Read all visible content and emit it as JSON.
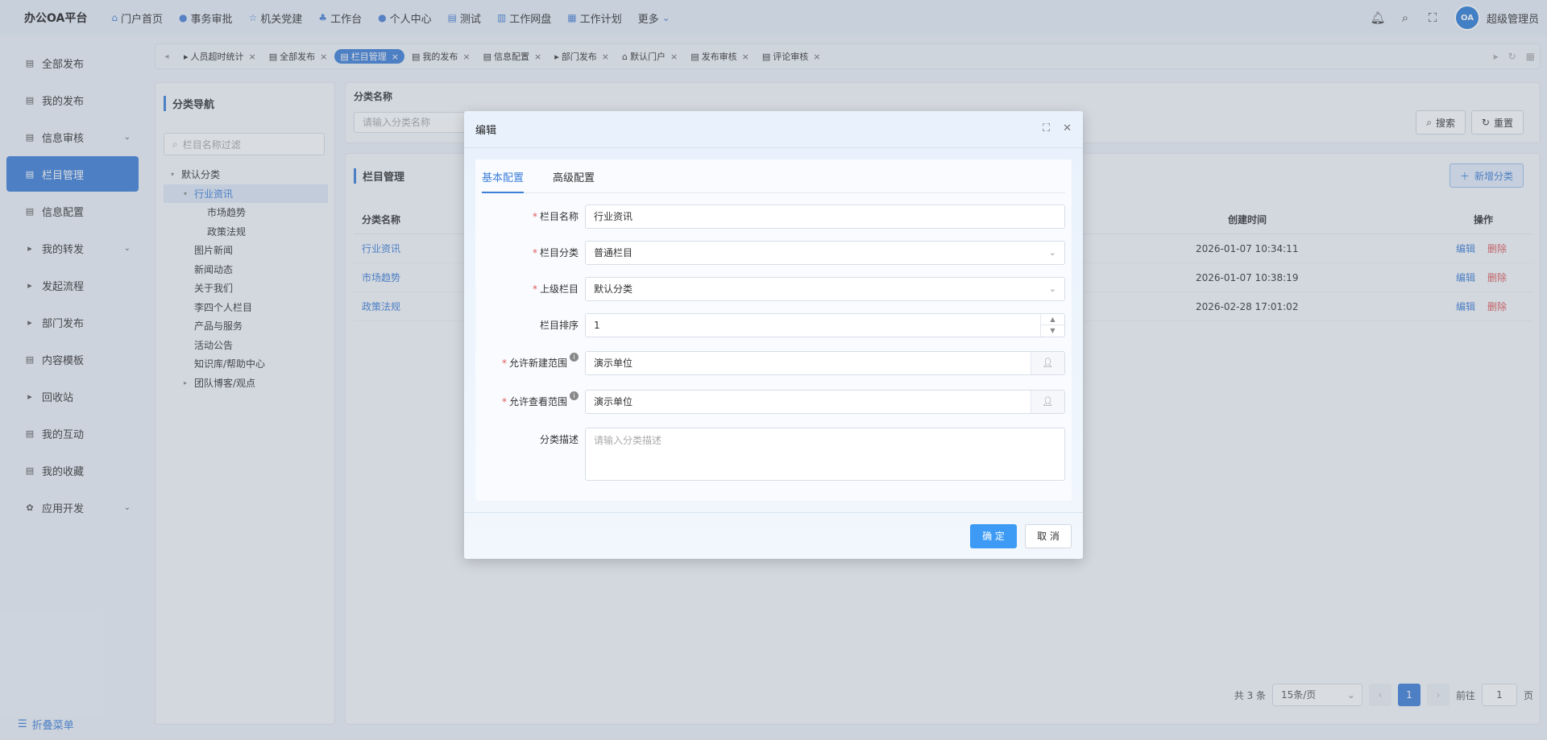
{
  "app": {
    "title": "办公OA平台",
    "user": "超级管理员",
    "avatar_text": "OA"
  },
  "topnav": [
    {
      "label": "门户首页",
      "icon": "home-icon",
      "glyph": "⌂"
    },
    {
      "label": "事务审批",
      "icon": "info-icon",
      "glyph": "●"
    },
    {
      "label": "机关党建",
      "icon": "star-icon",
      "glyph": "☆"
    },
    {
      "label": "工作台",
      "icon": "sitemap-icon",
      "glyph": "♣"
    },
    {
      "label": "个人中心",
      "icon": "user-icon",
      "glyph": "●"
    },
    {
      "label": "测试",
      "icon": "grid-icon",
      "glyph": "▤"
    },
    {
      "label": "工作网盘",
      "icon": "database-icon",
      "glyph": "▥"
    },
    {
      "label": "工作计划",
      "icon": "calendar-icon",
      "glyph": "▦"
    },
    {
      "label": "更多",
      "icon": "chevron-down-icon",
      "glyph": "⌄"
    }
  ],
  "sidebar": {
    "items": [
      {
        "label": "全部发布",
        "chev": "",
        "lead": "▤"
      },
      {
        "label": "我的发布",
        "chev": "",
        "lead": "▤"
      },
      {
        "label": "信息审核",
        "chev": "⌄",
        "lead": "▤"
      },
      {
        "label": "栏目管理",
        "chev": "",
        "lead": "▤"
      },
      {
        "label": "信息配置",
        "chev": "",
        "lead": "▤"
      },
      {
        "label": "我的转发",
        "chev": "⌄",
        "lead": "▸"
      },
      {
        "label": "发起流程",
        "chev": "",
        "lead": "▸"
      },
      {
        "label": "部门发布",
        "chev": "",
        "lead": "▸"
      },
      {
        "label": "内容模板",
        "chev": "",
        "lead": "▤"
      },
      {
        "label": "回收站",
        "chev": "",
        "lead": "▸"
      },
      {
        "label": "我的互动",
        "chev": "",
        "lead": "▤"
      },
      {
        "label": "我的收藏",
        "chev": "",
        "lead": "▤"
      },
      {
        "label": "应用开发",
        "chev": "⌄",
        "lead": "✿"
      }
    ],
    "collapse_label": "折叠菜单"
  },
  "tabs": [
    {
      "label": "人员超时统计",
      "lead": "▸"
    },
    {
      "label": "全部发布",
      "lead": "▤"
    },
    {
      "label": "栏目管理",
      "lead": "▤"
    },
    {
      "label": "我的发布",
      "lead": "▤"
    },
    {
      "label": "信息配置",
      "lead": "▤"
    },
    {
      "label": "部门发布",
      "lead": "▸"
    },
    {
      "label": "默认门户",
      "lead": "⌂"
    },
    {
      "label": "发布审核",
      "lead": "▤"
    },
    {
      "label": "评论审核",
      "lead": "▤"
    }
  ],
  "left_panel": {
    "title": "分类导航",
    "search_placeholder": "栏目名称过滤",
    "tree": [
      {
        "label": "默认分类",
        "toggle": "▾"
      },
      {
        "label": "行业资讯",
        "toggle": "▾"
      },
      {
        "label": "市场趋势",
        "toggle": ""
      },
      {
        "label": "政策法规",
        "toggle": ""
      },
      {
        "label": "图片新闻",
        "toggle": ""
      },
      {
        "label": "新闻动态",
        "toggle": ""
      },
      {
        "label": "关于我们",
        "toggle": ""
      },
      {
        "label": "李四个人栏目",
        "toggle": ""
      },
      {
        "label": "产品与服务",
        "toggle": ""
      },
      {
        "label": "活动公告",
        "toggle": ""
      },
      {
        "label": "知识库/帮助中心",
        "toggle": ""
      },
      {
        "label": "团队博客/观点",
        "toggle": "▸"
      }
    ]
  },
  "filter": {
    "label": "分类名称",
    "placeholder": "请输入分类名称",
    "search_label": "搜索",
    "reset_label": "重置"
  },
  "main": {
    "title": "栏目管理",
    "add_label": "新增分类",
    "columns": {
      "name": "分类名称",
      "created": "创建时间",
      "ops": "操作"
    },
    "rows": [
      {
        "name": "行业资讯",
        "created": "2026-01-07 10:34:11",
        "edit": "编辑",
        "delete": "删除"
      },
      {
        "name": "市场趋势",
        "created": "2026-01-07 10:38:19",
        "edit": "编辑",
        "delete": "删除"
      },
      {
        "name": "政策法规",
        "created": "2026-02-28 17:01:02",
        "edit": "编辑",
        "delete": "删除"
      }
    ],
    "pager": {
      "total": "共 3 条",
      "page_size": "15条/页",
      "current": "1",
      "goto_label": "前往",
      "goto_value": "1",
      "page_suffix": "页"
    }
  },
  "dialog": {
    "title": "编辑",
    "tabs": [
      "基本配置",
      "高级配置"
    ],
    "fields": {
      "name": {
        "label": "栏目名称",
        "value": "行业资讯"
      },
      "category": {
        "label": "栏目分类",
        "value": "普通栏目"
      },
      "parent": {
        "label": "上级栏目",
        "value": "默认分类"
      },
      "order": {
        "label": "栏目排序",
        "value": "1"
      },
      "create_scope": {
        "label": "允许新建范围",
        "value": "演示单位"
      },
      "view_scope": {
        "label": "允许查看范围",
        "value": "演示单位"
      },
      "desc": {
        "label": "分类描述",
        "placeholder": "请输入分类描述"
      }
    },
    "ok_label": "确 定",
    "cancel_label": "取 消"
  },
  "colors": {
    "accent": "#3d7fd9",
    "danger": "#e05a5a",
    "primary_button": "#3d9bf5"
  }
}
